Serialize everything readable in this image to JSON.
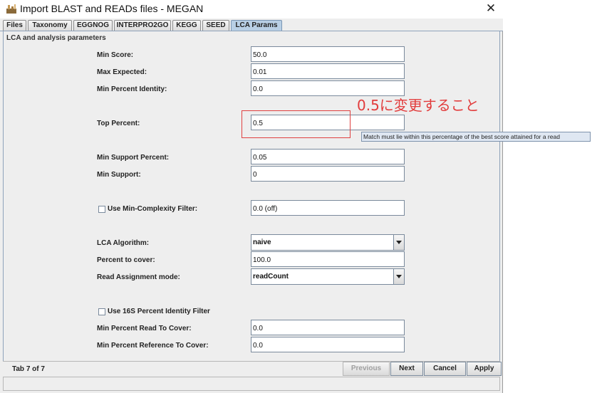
{
  "window": {
    "title": "Import BLAST and READs files - MEGAN",
    "close_glyph": "✕"
  },
  "tabs": [
    {
      "label": "Files"
    },
    {
      "label": "Taxonomy"
    },
    {
      "label": "EGGNOG"
    },
    {
      "label": "INTERPRO2GO"
    },
    {
      "label": "KEGG"
    },
    {
      "label": "SEED"
    },
    {
      "label": "LCA Params",
      "active": true
    }
  ],
  "section_title": "LCA and analysis parameters",
  "params": {
    "min_score": {
      "label": "Min Score:",
      "value": "50.0"
    },
    "max_expected": {
      "label": "Max Expected:",
      "value": "0.01"
    },
    "min_percent_identity": {
      "label": "Min Percent Identity:",
      "value": "0.0"
    },
    "top_percent": {
      "label": "Top Percent:",
      "value": "0.5"
    },
    "min_support_percent": {
      "label": "Min Support Percent:",
      "value": "0.05"
    },
    "min_support": {
      "label": "Min Support:",
      "value": "0"
    },
    "min_complexity": {
      "label": "Use Min-Complexity Filter:",
      "value": "0.0 (off)",
      "checked": false
    },
    "lca_algorithm": {
      "label": "LCA Algorithm:",
      "value": "naive"
    },
    "percent_to_cover": {
      "label": "Percent to cover:",
      "value": "100.0"
    },
    "read_assignment_mode": {
      "label": "Read Assignment mode:",
      "value": "readCount"
    },
    "use_16s_filter": {
      "label": "Use 16S Percent Identity Filter",
      "checked": false
    },
    "min_percent_read_to_cover": {
      "label": "Min Percent Read To Cover:",
      "value": "0.0"
    },
    "min_percent_reference_to_cover": {
      "label": "Min Percent Reference To Cover:",
      "value": "0.0"
    }
  },
  "tooltip": "Match must lie within this percentage of the best score attained for a read",
  "annotation": {
    "text": "0.5に変更すること",
    "color": "#e23c3c"
  },
  "status": "Tab 7 of 7",
  "buttons": {
    "previous": "Previous",
    "next": "Next",
    "cancel": "Cancel",
    "apply": "Apply"
  },
  "colors": {
    "active_tab": "#b8cfe5",
    "tooltip_bg": "#dfe7f2",
    "annotation": "#e04040"
  }
}
